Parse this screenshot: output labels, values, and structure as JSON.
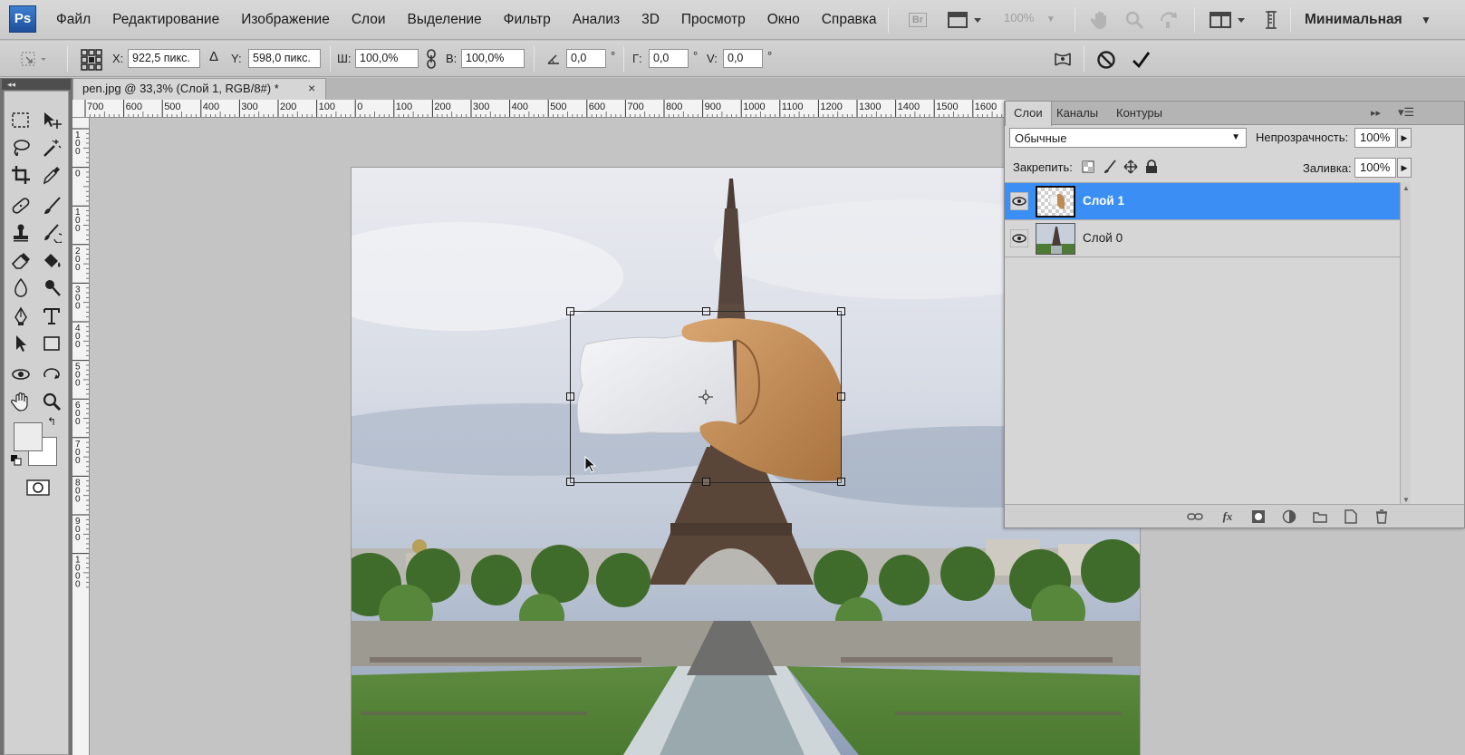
{
  "app": {
    "logo": "Ps"
  },
  "menu": [
    "Файл",
    "Редактирование",
    "Изображение",
    "Слои",
    "Выделение",
    "Фильтр",
    "Анализ",
    "3D",
    "Просмотр",
    "Окно",
    "Справка"
  ],
  "appbar": {
    "bridge_label": "Br",
    "zoom": "100%",
    "workspace": "Минимальная"
  },
  "options": {
    "x_label": "X:",
    "x_value": "922,5 пикс.",
    "y_label": "Y:",
    "y_value": "598,0 пикс.",
    "w_label": "Ш:",
    "w_value": "100,0%",
    "h_label": "В:",
    "h_value": "100,0%",
    "angle_value": "0,0",
    "angle_unit": "°",
    "hskew_label": "Г:",
    "hskew_value": "0,0",
    "hskew_unit": "°",
    "vskew_label": "V:",
    "vskew_value": "0,0",
    "vskew_unit": "°"
  },
  "document": {
    "tab_title": "pen.jpg @ 33,3% (Слой 1, RGB/8#) *",
    "close_glyph": "×"
  },
  "ruler": {
    "top_labels": [
      "700",
      "600",
      "500",
      "400",
      "300",
      "200",
      "100",
      "0",
      "100",
      "200",
      "300",
      "400",
      "500",
      "600",
      "700",
      "800",
      "900",
      "1000",
      "1100",
      "1200",
      "1300",
      "1400",
      "1500",
      "1600"
    ],
    "left_labels": [
      "1\n0\n0",
      "0",
      "1\n0\n0",
      "2\n0\n0",
      "3\n0\n0",
      "4\n0\n0",
      "5\n0\n0",
      "6\n0\n0",
      "7\n0\n0",
      "8\n0\n0",
      "9\n0\n0",
      "1\n0\n0\n0"
    ]
  },
  "layers_panel": {
    "tabs": [
      "Слои",
      "Каналы",
      "Контуры"
    ],
    "active_tab": 0,
    "blend_mode": "Обычные",
    "opacity_label": "Непрозрачность:",
    "opacity_value": "100%",
    "lock_label": "Закрепить:",
    "fill_label": "Заливка:",
    "fill_value": "100%",
    "layers": [
      {
        "name": "Слой 1",
        "selected": true,
        "visible": true
      },
      {
        "name": "Слой 0",
        "selected": false,
        "visible": true
      }
    ]
  },
  "colors": {
    "selection": "#3b8ff4",
    "foreground": "#ececec",
    "background": "#ffffff"
  }
}
